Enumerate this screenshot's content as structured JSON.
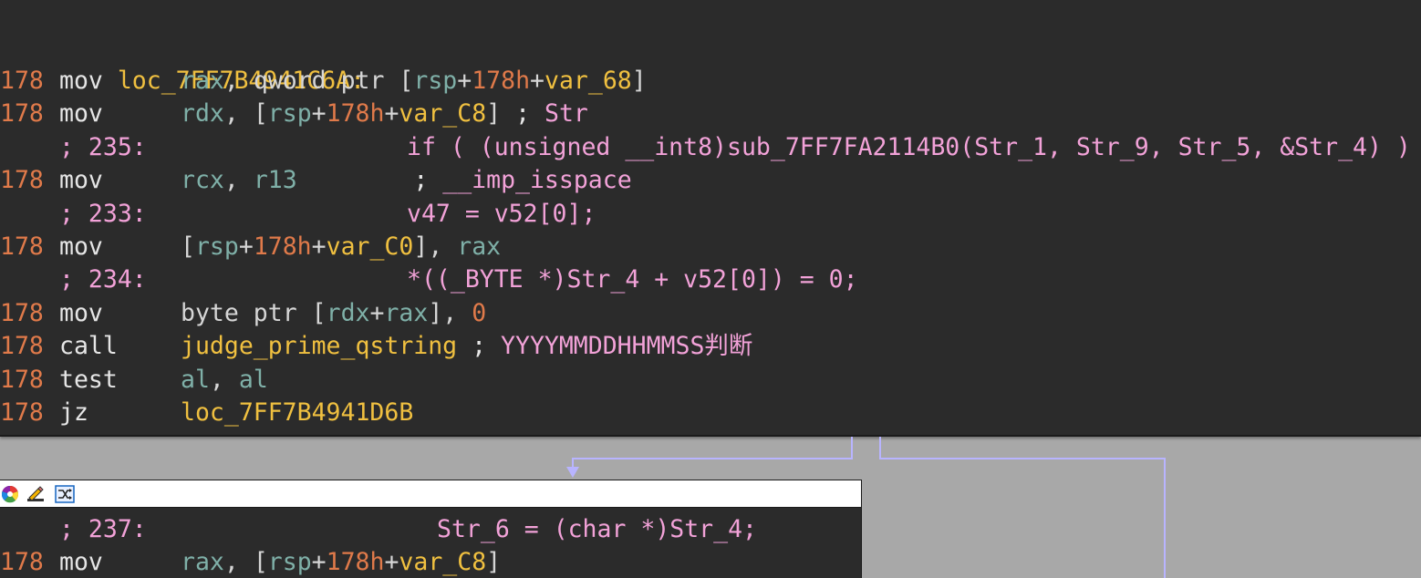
{
  "colors": {
    "background": "#a8a8a8",
    "node_bg": "#2b2b2b",
    "line_number": "#e07a4a",
    "register": "#7fb0a8",
    "variable": "#f0c040",
    "comment": "#f2a2d8",
    "edge": "#b8b4ff"
  },
  "top_node": {
    "label": "loc_7FF7B4941C6A:",
    "lines": [
      {
        "type": "asm",
        "no": "178",
        "mn": "mov",
        "ops": "rax, qword ptr [rsp+178h+var_68]"
      },
      {
        "type": "asm",
        "no": "178",
        "mn": "mov",
        "ops": "rdx, [rsp+178h+var_C8] ; Str"
      },
      {
        "type": "cmt",
        "ref": "; 235:",
        "code": "if ( (unsigned __int8)sub_7FF7FA2114B0(Str_1, Str_9, Str_5, &Str_4) )"
      },
      {
        "type": "asm",
        "no": "178",
        "mn": "mov",
        "ops": "rcx, r13        ; __imp_isspace"
      },
      {
        "type": "cmt",
        "ref": "; 233:",
        "code": "v47 = v52[0];"
      },
      {
        "type": "asm",
        "no": "178",
        "mn": "mov",
        "ops": "[rsp+178h+var_C0], rax"
      },
      {
        "type": "cmt",
        "ref": "; 234:",
        "code": "*((_BYTE *)Str_4 + v52[0]) = 0;"
      },
      {
        "type": "asm",
        "no": "178",
        "mn": "mov",
        "ops": "byte ptr [rdx+rax], 0"
      },
      {
        "type": "asm",
        "no": "178",
        "mn": "call",
        "ops": "judge_prime_qstring ; YYYYMMDDHHMMSS判断"
      },
      {
        "type": "asm",
        "no": "178",
        "mn": "test",
        "ops": "al, al"
      },
      {
        "type": "asm",
        "no": "178",
        "mn": "jz",
        "ops": "loc_7FF7B4941D6B"
      }
    ]
  },
  "bottom_node": {
    "toolbar_icons": [
      "color-wheel-icon",
      "edit-pencil-icon",
      "graph-layout-icon"
    ],
    "lines": [
      {
        "type": "cmt",
        "ref": "; 237:",
        "code": "Str_6 = (char *)Str_4;"
      },
      {
        "type": "asm",
        "no": "178",
        "mn": "mov",
        "ops": "rax, [rsp+178h+var_C8]"
      }
    ]
  }
}
